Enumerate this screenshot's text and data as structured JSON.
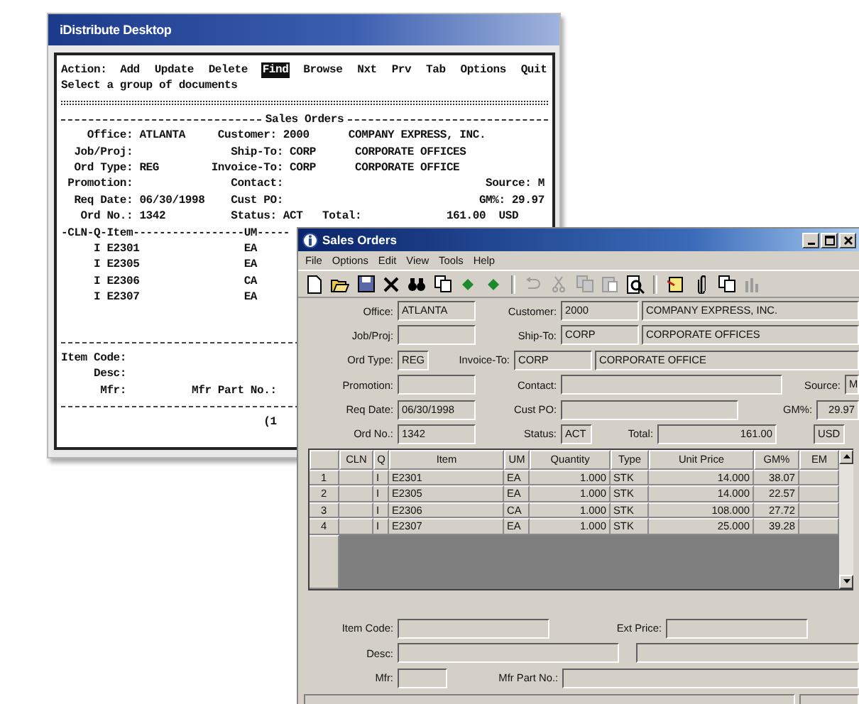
{
  "terminal_window": {
    "title": "iDistribute Desktop",
    "action_label": "Action:",
    "actions": [
      {
        "label": "Add",
        "selected": false
      },
      {
        "label": "Update",
        "selected": false
      },
      {
        "label": "Delete",
        "selected": false
      },
      {
        "label": "Find",
        "selected": true
      },
      {
        "label": "Browse",
        "selected": false
      },
      {
        "label": "Nxt",
        "selected": false
      },
      {
        "label": "Prv",
        "selected": false
      },
      {
        "label": "Tab",
        "selected": false
      },
      {
        "label": "Options",
        "selected": false
      },
      {
        "label": "Quit",
        "selected": false
      }
    ],
    "prompt": "Select a group of documents",
    "section_title": "Sales Orders",
    "header_lines": [
      "    Office: ATLANTA     Customer: 2000      COMPANY EXPRESS, INC.",
      "  Job/Proj:               Ship-To: CORP      CORPORATE OFFICES",
      "  Ord Type: REG        Invoice-To: CORP      CORPORATE OFFICE",
      " Promotion:               Contact:                               Source: M",
      "  Req Date: 06/30/1998    Cust PO:                              GM%: 29.97",
      "   Ord No.: 1342          Status: ACT   Total:             161.00  USD"
    ],
    "item_header": "-CLN-Q-Item-----------------UM-----",
    "item_lines": [
      "     I E2301                EA",
      "     I E2305                EA",
      "     I E2306                CA",
      "     I E2307                EA"
    ],
    "detail_lines": [
      "Item Code:",
      "     Desc:",
      "      Mfr:          Mfr Part No.:"
    ],
    "footer": "                               (1"
  },
  "sales_orders_window": {
    "title": "Sales Orders",
    "menu": [
      "File",
      "Options",
      "Edit",
      "View",
      "Tools",
      "Help"
    ],
    "toolbar": [
      {
        "kind": "new",
        "disabled": false
      },
      {
        "kind": "open",
        "disabled": false
      },
      {
        "kind": "save",
        "disabled": false
      },
      {
        "kind": "delete",
        "disabled": false
      },
      {
        "kind": "find",
        "disabled": false
      },
      {
        "kind": "copy",
        "disabled": false
      },
      {
        "kind": "previous",
        "disabled": false
      },
      {
        "kind": "next",
        "disabled": false
      },
      {
        "kind": "separator"
      },
      {
        "kind": "undo",
        "disabled": true
      },
      {
        "kind": "cut",
        "disabled": true
      },
      {
        "kind": "copy",
        "disabled": true
      },
      {
        "kind": "paste",
        "disabled": true
      },
      {
        "kind": "preview",
        "disabled": false
      },
      {
        "kind": "separator"
      },
      {
        "kind": "note",
        "disabled": false
      },
      {
        "kind": "attach",
        "disabled": false
      },
      {
        "kind": "copy",
        "disabled": false
      },
      {
        "kind": "report",
        "disabled": true
      }
    ],
    "header_rows": [
      [
        {
          "label": "Office:",
          "value": "ATLANTA",
          "kind": "medium"
        },
        {
          "label": "Customer:",
          "value": "2000",
          "kind": "medium"
        },
        {
          "value": "COMPANY EXPRESS, INC.",
          "kind": "fill"
        }
      ],
      [
        {
          "label": "Job/Proj:",
          "kind": "medium"
        },
        {
          "label": "Ship-To:",
          "value": "CORP",
          "kind": "medium"
        },
        {
          "value": "CORPORATE OFFICES",
          "kind": "fill"
        }
      ],
      [
        {
          "label": "Ord Type:",
          "value": "REG",
          "kind": "short"
        },
        {
          "label": "Invoice-To:",
          "value": "CORP",
          "kind": "medium"
        },
        {
          "value": "CORPORATE OFFICE",
          "kind": "fill"
        }
      ],
      [
        {
          "label": "Promotion:",
          "kind": "medium"
        },
        {
          "label": "Contact:",
          "kind": "xl"
        },
        {
          "label": "Source:",
          "value": "M",
          "kind": "xs"
        }
      ],
      [
        {
          "label": "Req Date:",
          "value": "06/30/1998",
          "kind": "medium"
        },
        {
          "label": "Cust PO:",
          "kind": "long"
        },
        {
          "label": "GM%:",
          "value": "29.97",
          "kind": "num"
        }
      ],
      [
        {
          "label": "Ord No.:",
          "value": "1342",
          "kind": "medium"
        },
        {
          "label": "Status:",
          "value": "ACT",
          "kind": "short"
        },
        {
          "label": "Total:",
          "value": "161.00",
          "kind": "total"
        },
        {
          "value": "USD",
          "kind": "currency"
        }
      ]
    ],
    "grid": {
      "columns": [
        "CLN",
        "Q",
        "Item",
        "UM",
        "Quantity",
        "Type",
        "Unit Price",
        "GM%",
        "EM"
      ],
      "rows": [
        {
          "number": "1",
          "q": "I",
          "item": "E2301",
          "um": "EA",
          "quantity": "1.000",
          "type": "STK",
          "unit_price": "14.000",
          "gm": "38.07"
        },
        {
          "number": "2",
          "q": "I",
          "item": "E2305",
          "um": "EA",
          "quantity": "1.000",
          "type": "STK",
          "unit_price": "14.000",
          "gm": "22.57"
        },
        {
          "number": "3",
          "q": "I",
          "item": "E2306",
          "um": "CA",
          "quantity": "1.000",
          "type": "STK",
          "unit_price": "108.000",
          "gm": "27.72"
        },
        {
          "number": "4",
          "q": "I",
          "item": "E2307",
          "um": "EA",
          "quantity": "1.000",
          "type": "STK",
          "unit_price": "25.000",
          "gm": "39.28"
        }
      ]
    },
    "detail_rows": [
      [
        {
          "label": "Item Code:",
          "kind": "item"
        },
        {
          "label": "Ext Price:",
          "kind": "price"
        }
      ],
      [
        {
          "label": "Desc:",
          "kind": "desc"
        },
        {
          "kind": "fill"
        }
      ],
      [
        {
          "label": "Mfr:",
          "kind": "tiny"
        },
        {
          "label": "Mfr Part No.:",
          "kind": "fill"
        }
      ]
    ]
  }
}
